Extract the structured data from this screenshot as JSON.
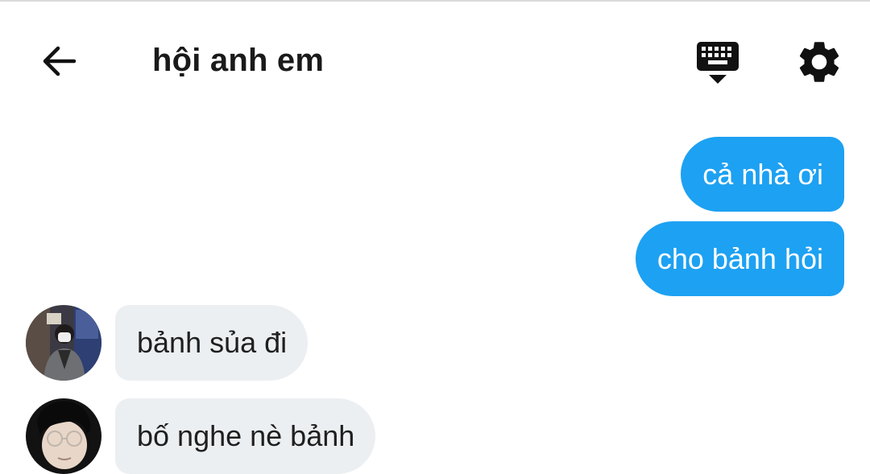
{
  "header": {
    "title": "hội anh em"
  },
  "messages": [
    {
      "direction": "out",
      "text": "cả nhà ơi"
    },
    {
      "direction": "out",
      "text": "cho bảnh hỏi"
    },
    {
      "direction": "in",
      "text": "bảnh sủa đi"
    },
    {
      "direction": "in",
      "text": "bố nghe nè bảnh"
    }
  ],
  "icons": {
    "back": "arrow-left-icon",
    "keyboard": "keyboard-icon",
    "settings": "gear-icon"
  },
  "colors": {
    "outgoing_bubble": "#1da1f2",
    "incoming_bubble": "#eceff2",
    "title_text": "#1a1a1a"
  }
}
